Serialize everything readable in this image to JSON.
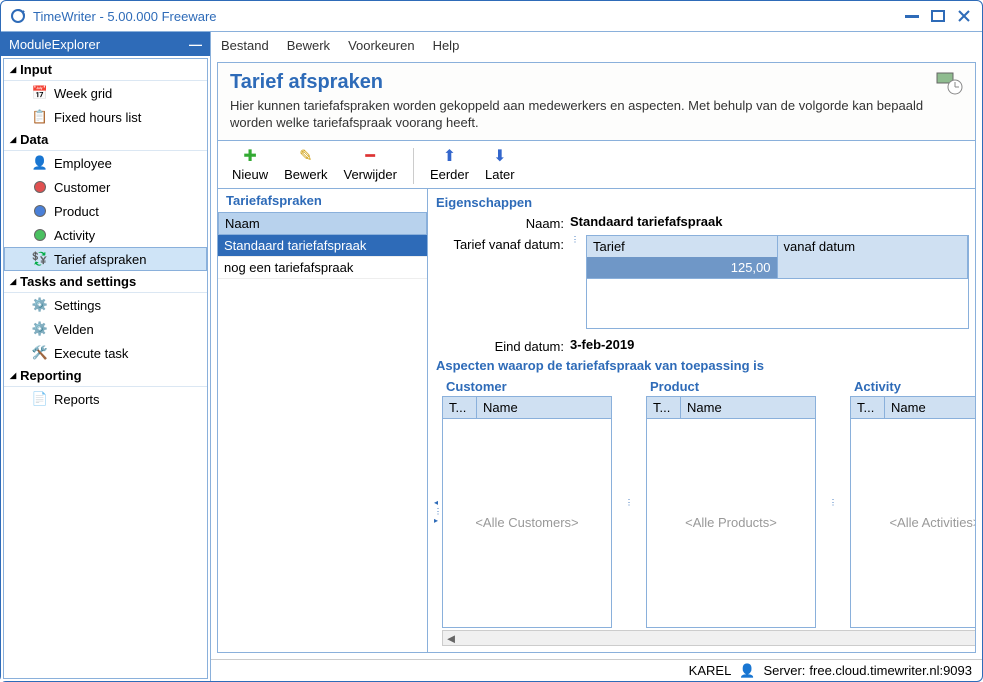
{
  "window": {
    "title": "TimeWriter - 5.00.000 Freeware"
  },
  "module_explorer": {
    "title": "ModuleExplorer"
  },
  "tree": {
    "input": {
      "label": "Input",
      "items": [
        {
          "label": "Week grid"
        },
        {
          "label": "Fixed hours list"
        }
      ]
    },
    "data": {
      "label": "Data",
      "items": [
        {
          "label": "Employee"
        },
        {
          "label": "Customer"
        },
        {
          "label": "Product"
        },
        {
          "label": "Activity"
        },
        {
          "label": "Tarief afspraken"
        }
      ]
    },
    "tasks": {
      "label": "Tasks and settings",
      "items": [
        {
          "label": "Settings"
        },
        {
          "label": "Velden"
        },
        {
          "label": "Execute task"
        }
      ]
    },
    "reporting": {
      "label": "Reporting",
      "items": [
        {
          "label": "Reports"
        }
      ]
    }
  },
  "menubar": {
    "items": [
      "Bestand",
      "Bewerk",
      "Voorkeuren",
      "Help"
    ]
  },
  "page": {
    "title": "Tarief afspraken",
    "subtitle": "Hier kunnen tariefafspraken worden gekoppeld aan medewerkers en aspecten. Met behulp van de volgorde kan bepaald worden welke tariefafspraak voorang heeft."
  },
  "toolbar": {
    "nieuw": "Nieuw",
    "bewerk": "Bewerk",
    "verwijder": "Verwijder",
    "eerder": "Eerder",
    "later": "Later"
  },
  "list": {
    "title": "Tariefafspraken",
    "col": "Naam",
    "rows": [
      "Standaard tariefafspraak",
      "nog een tariefafspraak"
    ]
  },
  "properties": {
    "title": "Eigenschappen",
    "naam_label": "Naam:",
    "naam_value": "Standaard tariefafspraak",
    "tarief_vanaf_label": "Tarief vanaf datum:",
    "tarief_col": "Tarief",
    "vanaf_col": "vanaf datum",
    "tarief_value": "125,00",
    "vanaf_value": "",
    "eind_label": "Eind datum:",
    "eind_value": "3-feb-2019"
  },
  "aspects": {
    "title": "Aspecten waarop de tariefafspraak van toepassing is",
    "col_t": "T...",
    "col_name": "Name",
    "boxes": [
      {
        "title": "Customer",
        "placeholder": "<Alle Customers>"
      },
      {
        "title": "Product",
        "placeholder": "<Alle Products>"
      },
      {
        "title": "Activity",
        "placeholder": "<Alle Activities>"
      }
    ]
  },
  "status": {
    "user": "KAREL",
    "server_label": "Server:",
    "server": "free.cloud.timewriter.nl:9093"
  }
}
